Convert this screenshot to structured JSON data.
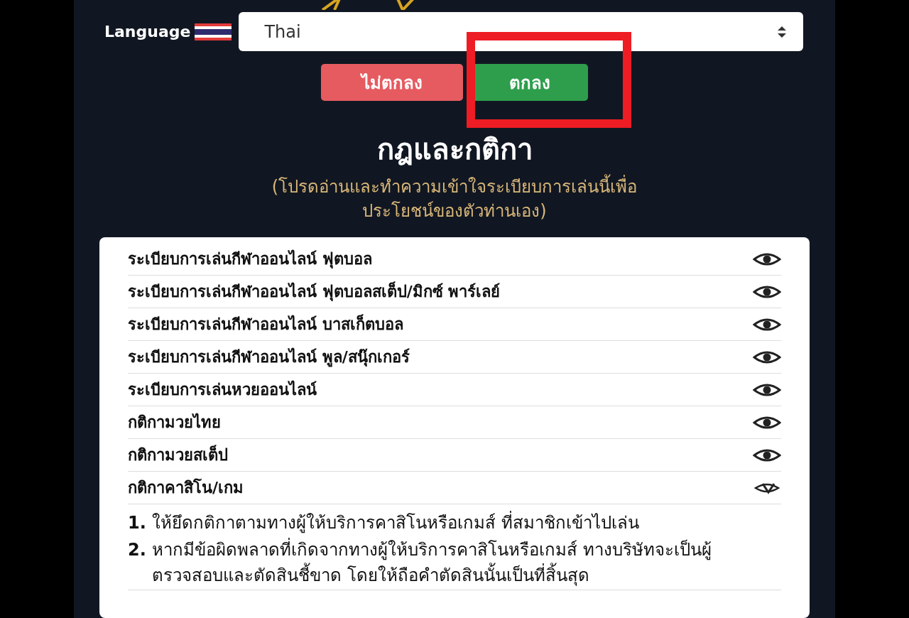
{
  "language": {
    "label": "Language",
    "value": "Thai"
  },
  "buttons": [
    {
      "label": "ไม่ตกลง",
      "kind": "decline"
    },
    {
      "label": "ตกลง",
      "kind": "accept"
    }
  ],
  "title": "กฎและกติกา",
  "subtitle_lines": [
    "(โปรดอ่านและทำความเข้าใจระเบียบการเล่นนี้เพื่อ",
    "ประโยชน์ของตัวท่านเอง)"
  ],
  "rules": [
    {
      "label": "ระเบียบการเล่นกีฬาออนไลน์ ฟุตบอล",
      "expanded": false
    },
    {
      "label": "ระเบียบการเล่นกีฬาออนไลน์ ฟุตบอลสเต็ป/มิกซ์ พาร์เลย์",
      "expanded": false
    },
    {
      "label": "ระเบียบการเล่นกีฬาออนไลน์ บาสเก็ตบอล",
      "expanded": false
    },
    {
      "label": "ระเบียบการเล่นกีฬาออนไลน์ พูล/สนุ๊กเกอร์",
      "expanded": false
    },
    {
      "label": "ระเบียบการเล่นหวยออนไลน์",
      "expanded": false
    },
    {
      "label": "กติกามวยไทย",
      "expanded": false
    },
    {
      "label": "กติกามวยสเต็ป",
      "expanded": false
    },
    {
      "label": "กติกาคาสิโน/เกม",
      "expanded": true,
      "content": [
        {
          "number": "1.",
          "text": "ให้ยึดกติกาตามทางผู้ให้บริการคาสิโนหรือเกมส์ ที่สมาชิกเข้าไปเล่น"
        },
        {
          "number": "2.",
          "text": "หากมีข้อผิดพลาดที่เกิดจากทางผู้ให้บริการคาสิโนหรือเกมส์ ทางบริษัทจะเป็นผู้ตรวจสอบและตัดสินชี้ขาด โดยให้ถือคำตัดสินนั้นเป็นที่สิ้นสุด"
        }
      ]
    }
  ]
}
